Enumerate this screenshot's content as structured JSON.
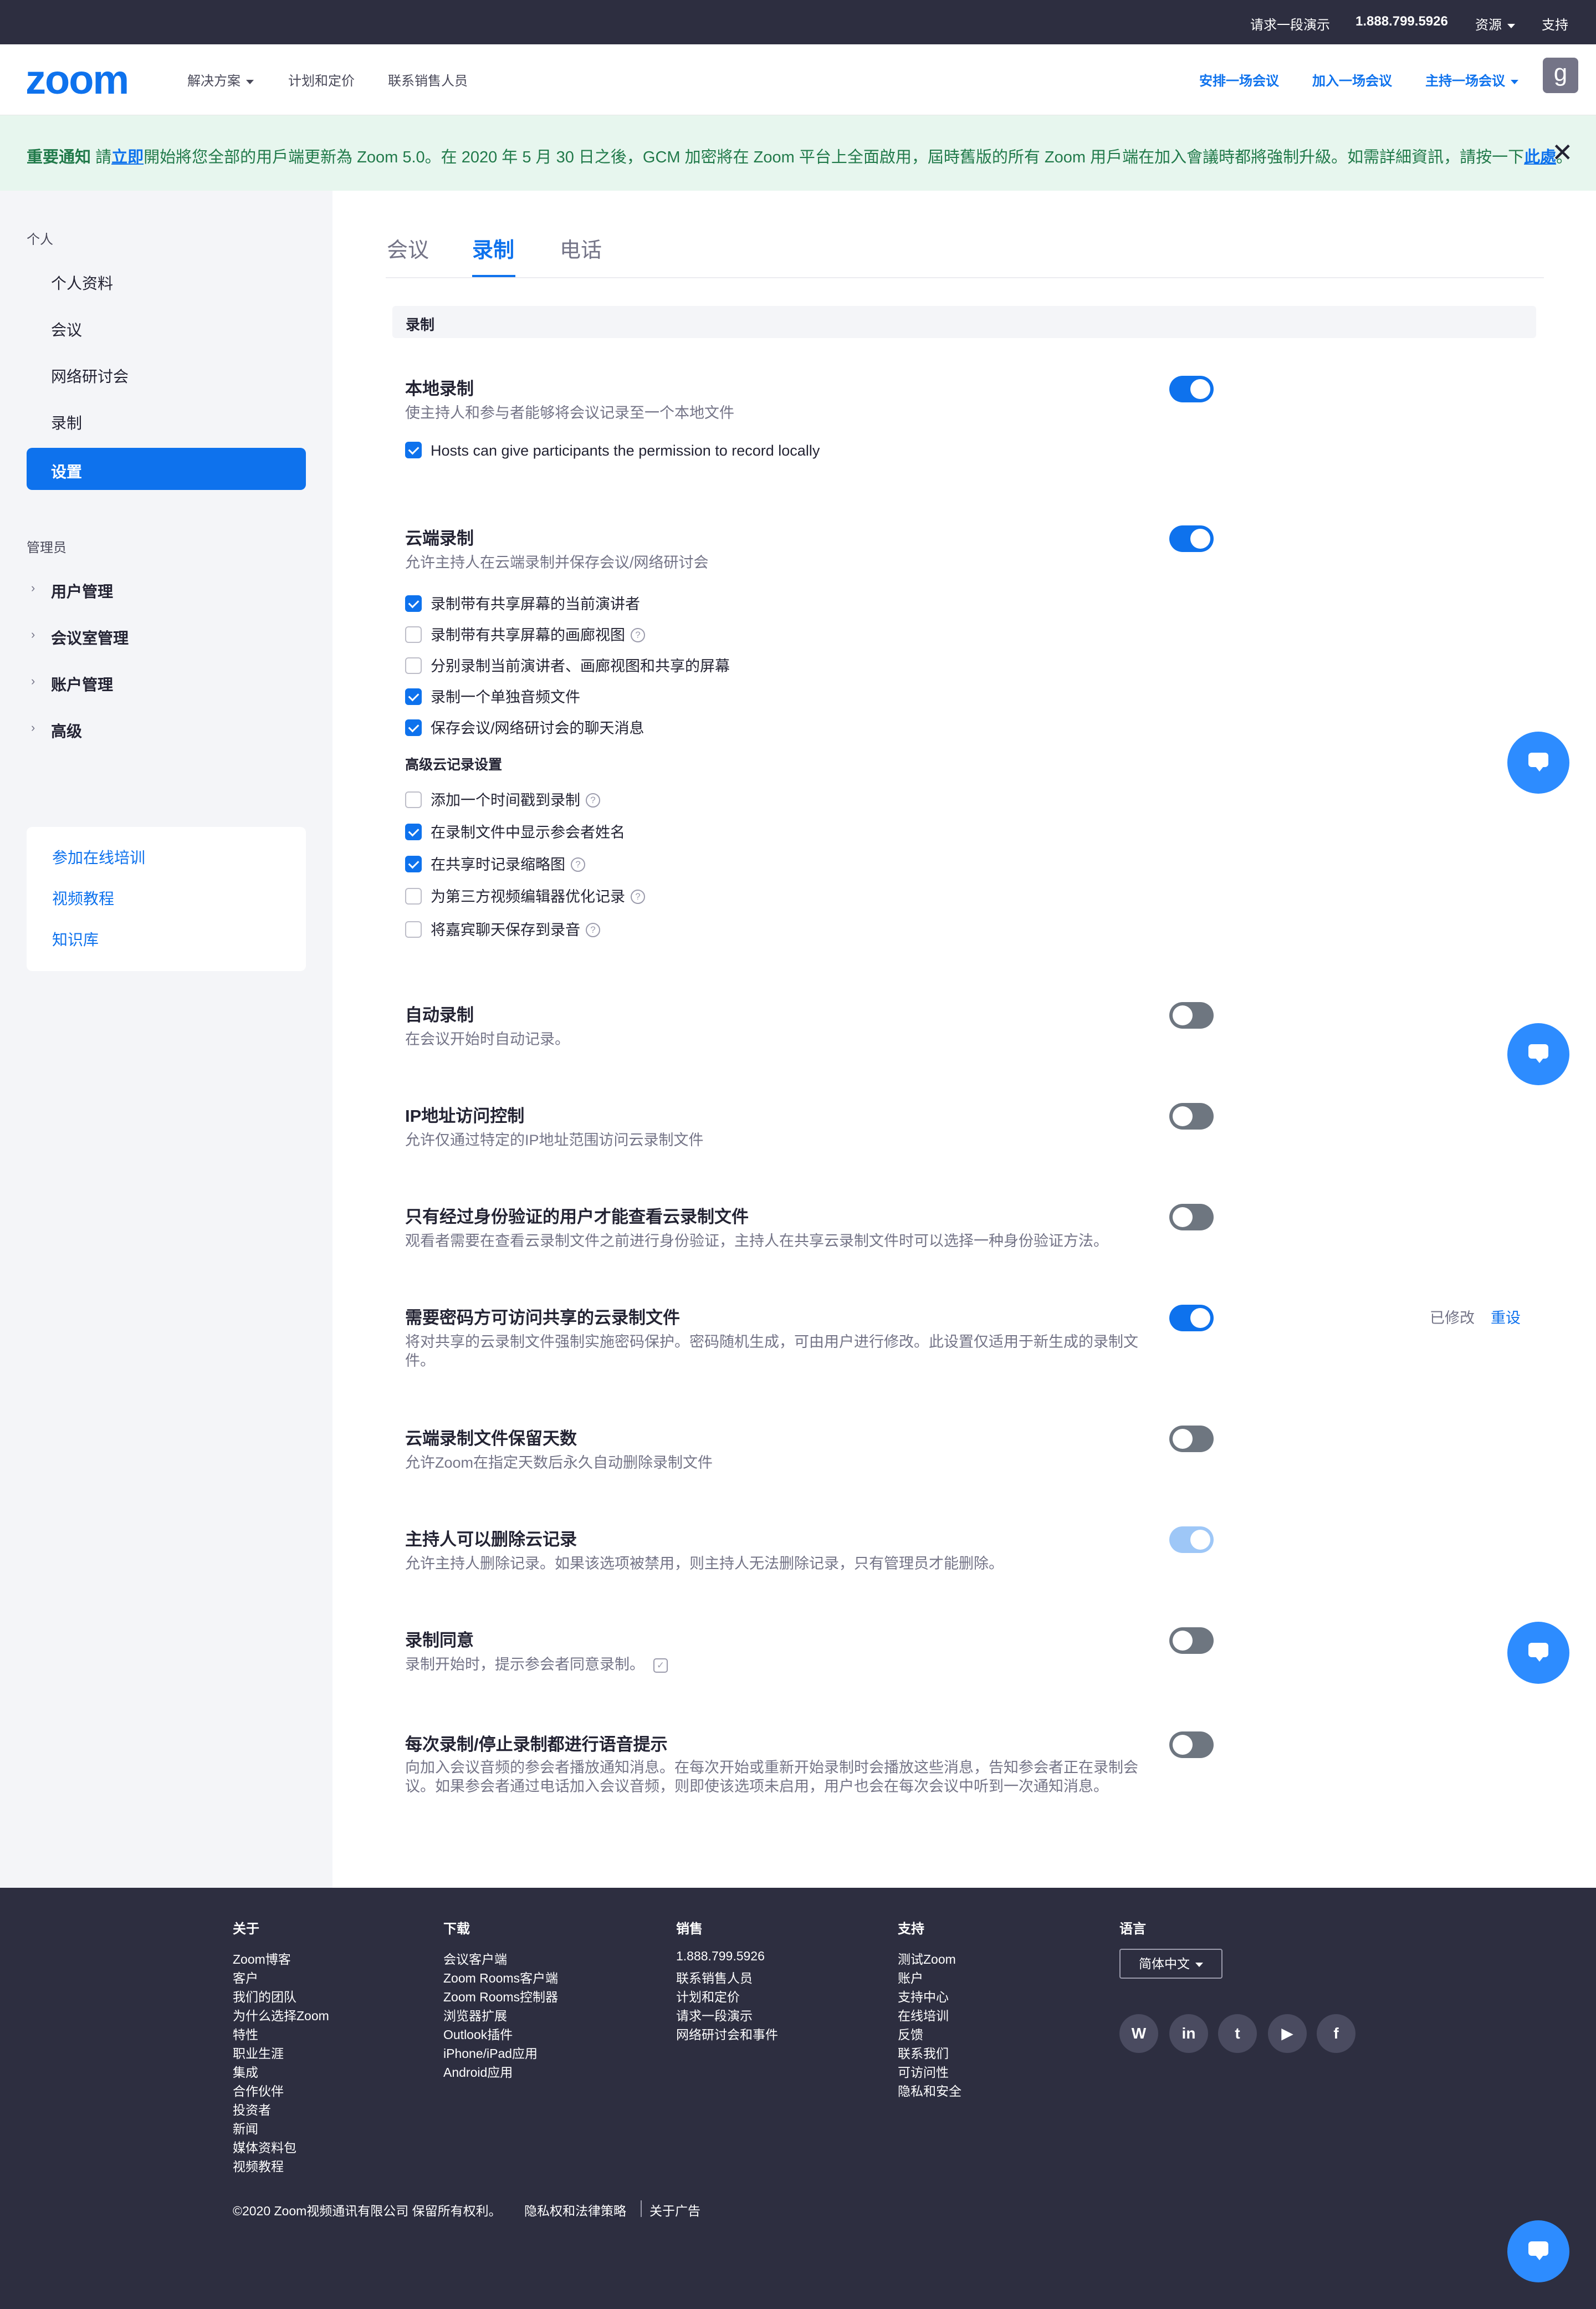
{
  "topbar": {
    "demo": "请求一段演示",
    "phone": "1.888.799.5926",
    "resources": "资源",
    "support": "支持"
  },
  "header": {
    "logo": "zoom",
    "nav": [
      "解决方案",
      "计划和定价",
      "联系销售人员"
    ],
    "actions": [
      "安排一场会议",
      "加入一场会议",
      "主持一场会议"
    ],
    "avatar": "g"
  },
  "notice": {
    "bold": "重要通知",
    "pre": " 請",
    "link1": "立即",
    "mid": "開始將您全部的用戶端更新為 Zoom 5.0。在 2020 年 5 月 30 日之後，GCM 加密將在 Zoom 平台上全面啟用，屆時舊版的所有 Zoom 用戶端在加入會議時都將強制升級。如需詳細資訊，請按一下",
    "link2": "此處",
    "end": "。"
  },
  "sidebar": {
    "personal_header": "个人",
    "personal": [
      "个人资料",
      "会议",
      "网络研讨会",
      "录制",
      "设置"
    ],
    "admin_header": "管理员",
    "admin": [
      "用户管理",
      "会议室管理",
      "账户管理",
      "高级"
    ],
    "links": [
      "参加在线培训",
      "视频教程",
      "知识库"
    ]
  },
  "tabs": [
    "会议",
    "录制",
    "电话"
  ],
  "section_header": "录制",
  "settings": {
    "local": {
      "title": "本地录制",
      "desc": "使主持人和参与者能够将会议记录至一个本地文件",
      "enabled": true,
      "option": "Hosts can give participants the permission to record locally"
    },
    "cloud": {
      "title": "云端录制",
      "desc": "允许主持人在云端录制并保存会议/网络研讨会",
      "enabled": true,
      "options": [
        {
          "label": "录制带有共享屏幕的当前演讲者",
          "checked": true
        },
        {
          "label": "录制带有共享屏幕的画廊视图",
          "checked": false
        },
        {
          "label": "分别录制当前演讲者、画廊视图和共享的屏幕",
          "checked": false
        },
        {
          "label": "录制一个单独音频文件",
          "checked": true
        },
        {
          "label": "保存会议/网络研讨会的聊天消息",
          "checked": true
        }
      ],
      "advanced_header": "高级云记录设置",
      "advanced": [
        {
          "label": "添加一个时间戳到录制",
          "checked": false
        },
        {
          "label": "在录制文件中显示参会者姓名",
          "checked": true
        },
        {
          "label": "在共享时记录缩略图",
          "checked": true
        },
        {
          "label": "为第三方视频编辑器优化记录",
          "checked": false
        },
        {
          "label": "将嘉宾聊天保存到录音",
          "checked": false
        }
      ]
    },
    "auto": {
      "title": "自动录制",
      "desc": "在会议开始时自动记录。",
      "enabled": false
    },
    "ip": {
      "title": "IP地址访问控制",
      "desc": "允许仅通过特定的IP地址范围访问云录制文件",
      "enabled": false
    },
    "auth": {
      "title": "只有经过身份验证的用户才能查看云录制文件",
      "desc": "观看者需要在查看云录制文件之前进行身份验证，主持人在共享云录制文件时可以选择一种身份验证方法。",
      "enabled": false
    },
    "password": {
      "title": "需要密码方可访问共享的云录制文件",
      "desc": "将对共享的云录制文件强制实施密码保护。密码随机生成，可由用户进行修改。此设置仅适用于新生成的录制文件。",
      "enabled": true,
      "modified": "已修改",
      "reset": "重设"
    },
    "retention": {
      "title": "云端录制文件保留天数",
      "desc": "允许Zoom在指定天数后永久自动删除录制文件",
      "enabled": false
    },
    "delete": {
      "title": "主持人可以删除云记录",
      "desc": "允许主持人删除记录。如果该选项被禁用，则主持人无法删除记录，只有管理员才能删除。",
      "enabled": true,
      "locked": true
    },
    "consent": {
      "title": "录制同意",
      "desc": "录制开始时，提示参会者同意录制。",
      "enabled": false
    },
    "voice": {
      "title": "每次录制/停止录制都进行语音提示",
      "desc": "向加入会议音频的参会者播放通知消息。在每次开始或重新开始录制时会播放这些消息，告知参会者正在录制会议。如果参会者通过电话加入会议音频，则即使该选项未启用，用户也会在每次会议中听到一次通知消息。",
      "enabled": false
    }
  },
  "footer": {
    "cols": [
      {
        "title": "关于",
        "items": [
          "Zoom博客",
          "客户",
          "我们的团队",
          "为什么选择Zoom",
          "特性",
          "职业生涯",
          "集成",
          "合作伙伴",
          "投资者",
          "新闻",
          "媒体资料包",
          "视频教程"
        ]
      },
      {
        "title": "下载",
        "items": [
          "会议客户端",
          "Zoom Rooms客户端",
          "Zoom Rooms控制器",
          "浏览器扩展",
          "Outlook插件",
          "iPhone/iPad应用",
          "Android应用"
        ]
      },
      {
        "title": "销售",
        "items": [
          "1.888.799.5926",
          "联系销售人员",
          "计划和定价",
          "请求一段演示",
          "网络研讨会和事件"
        ]
      },
      {
        "title": "支持",
        "items": [
          "测试Zoom",
          "账户",
          "支持中心",
          "在线培训",
          "反馈",
          "联系我们",
          "可访问性",
          "隐私和安全"
        ]
      }
    ],
    "language_title": "语言",
    "language": "简体中文",
    "social": [
      "wordpress-icon",
      "linkedin-icon",
      "twitter-icon",
      "youtube-icon",
      "facebook-icon"
    ],
    "copyright": "©2020 Zoom视频通讯有限公司 保留所有权利。",
    "privacy": "隐私权和法律策略",
    "ads": "关于广告"
  },
  "colors": {
    "accent": "#0e72ed",
    "dark": "#2d2e40",
    "notice_bg": "#e7f6ee",
    "notice_text": "#217a4a"
  }
}
